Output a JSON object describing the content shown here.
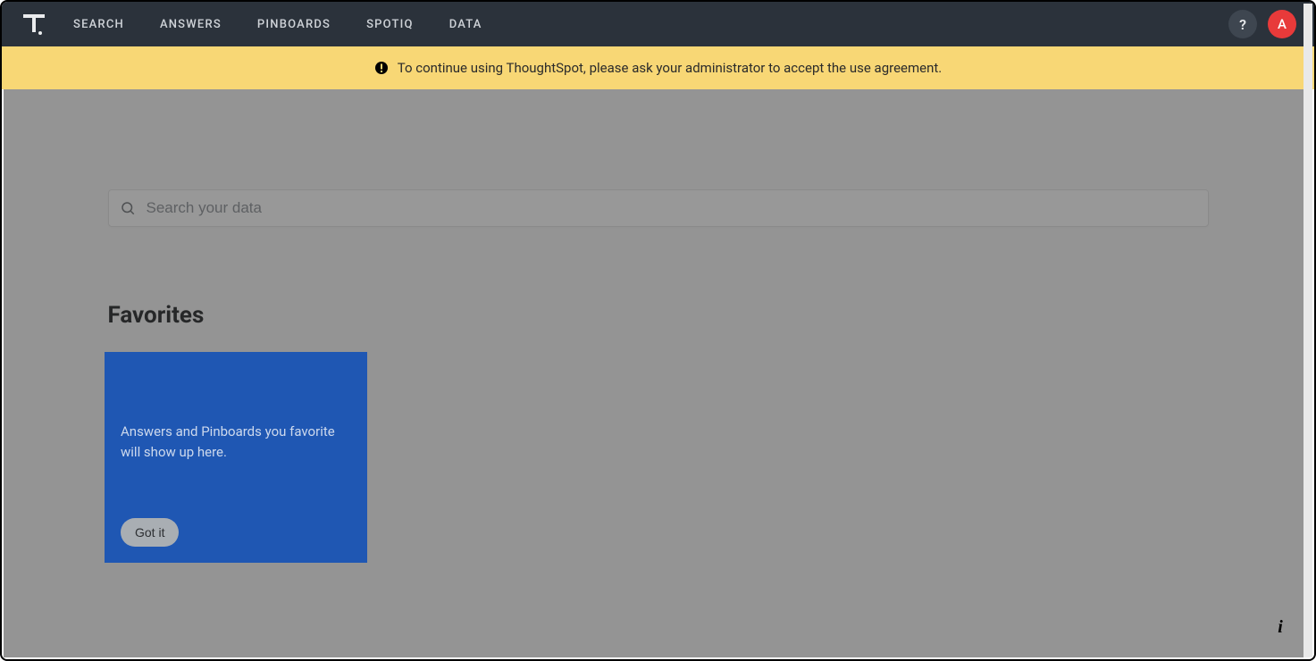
{
  "nav": {
    "items": [
      "SEARCH",
      "ANSWERS",
      "PINBOARDS",
      "SPOTIQ",
      "DATA"
    ],
    "help_label": "?",
    "avatar_initial": "A"
  },
  "notice": {
    "text": "To continue using ThoughtSpot, please ask your administrator to accept the use agreement."
  },
  "search": {
    "placeholder": "Search your data"
  },
  "favorites": {
    "heading": "Favorites",
    "callout_text": "Answers and Pinboards you favorite will show up here.",
    "callout_button": "Got it"
  },
  "info_bubble": "i"
}
